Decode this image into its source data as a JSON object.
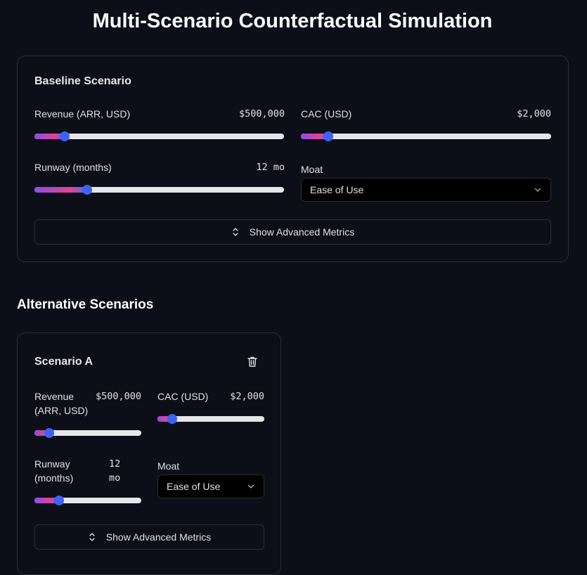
{
  "page": {
    "title": "Multi-Scenario Counterfactual Simulation"
  },
  "baseline": {
    "title": "Baseline Scenario",
    "revenue": {
      "label": "Revenue (ARR, USD)",
      "value": "$500,000",
      "level": 0.12
    },
    "cac": {
      "label": "CAC (USD)",
      "value": "$2,000",
      "level": 0.11
    },
    "runway": {
      "label": "Runway (months)",
      "value": "12 mo",
      "level": 0.21
    },
    "moat": {
      "label": "Moat",
      "selected": "Ease of Use"
    },
    "advanced_button": "Show Advanced Metrics"
  },
  "alternatives": {
    "title": "Alternative Scenarios",
    "scenarios": [
      {
        "title": "Scenario A",
        "revenue": {
          "label": "Revenue (ARR, USD)",
          "value": "$500,000",
          "level": 0.14
        },
        "cac": {
          "label": "CAC (USD)",
          "value": "$2,000",
          "level": 0.14
        },
        "runway": {
          "label": "Runway (months)",
          "value": "12 mo",
          "level": 0.23
        },
        "moat": {
          "label": "Moat",
          "selected": "Ease of Use"
        },
        "advanced_button": "Show Advanced Metrics"
      }
    ]
  },
  "icons": {
    "select_chevron": "chevron-down-icon",
    "expand": "chevrons-up-down-icon",
    "delete": "trash-icon"
  },
  "colors": {
    "background": "#0d0f18",
    "thumb": "#3b63f5",
    "track": "#e6e7ea",
    "fill_gradient": [
      "#8a4de8",
      "#e0458f",
      "#4a68f0"
    ]
  }
}
